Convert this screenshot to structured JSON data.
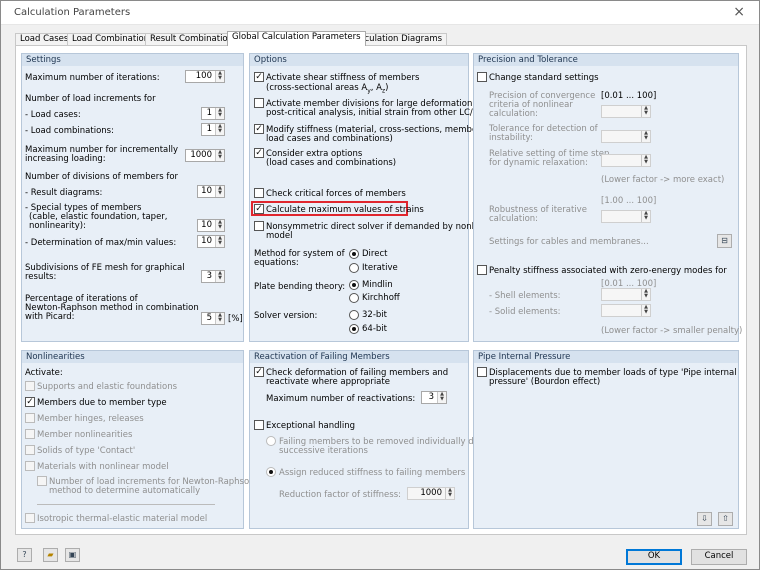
{
  "window": {
    "title": "Calculation Parameters",
    "close": "×"
  },
  "tabs": [
    "Load Cases",
    "Load Combinations",
    "Result Combinations",
    "Global Calculation Parameters",
    "Calculation Diagrams"
  ],
  "settings": {
    "title": "Settings",
    "max_iter_label": "Maximum number of iterations:",
    "max_iter": "100",
    "load_incr_label": "Number of load increments for",
    "load_cases_label": "- Load cases:",
    "load_cases": "1",
    "load_comb_label": "- Load combinations:",
    "load_comb": "1",
    "max_incr_label1": "Maximum number for incrementally",
    "max_incr_label2": "increasing loading:",
    "max_incr": "1000",
    "divisions_label": "Number of divisions of members for",
    "result_diag_label": "- Result diagrams:",
    "result_diag": "10",
    "special_l1": "- Special types of members",
    "special_l2": "(cable, elastic foundation, taper,",
    "special_l3": "nonlinearity):",
    "special": "10",
    "maxmin_label": "- Determination of max/min values:",
    "maxmin": "10",
    "fe_l1": "Subdivisions of FE mesh for graphical",
    "fe_l2": "results:",
    "fe": "3",
    "pct_l1": "Percentage of iterations of",
    "pct_l2": "Newton-Raphson method in combination",
    "pct_l3": "with Picard:",
    "pct": "5",
    "pct_unit": "[%]"
  },
  "options": {
    "title": "Options",
    "o1a": "Activate shear stiffness of members",
    "o1b": "(cross-sectional areas A",
    "o1c": "y",
    "o1d": ", A",
    "o1e": "z",
    "o1f": ")",
    "o2a": "Activate member divisions for large deformation or",
    "o2b": "post-critical analysis, initial strain from other LC/CO",
    "o3a": "Modify stiffness (material, cross-sections, members,",
    "o3b": "load cases and combinations)",
    "o4a": "Consider extra options",
    "o4b": "(load cases and combinations)",
    "o5": "Check critical forces of members",
    "o6": "Calculate maximum values of strains",
    "o7a": "Nonsymmetric direct solver if demanded by nonlinear",
    "o7b": "model",
    "method_l1": "Method for system of",
    "method_l2": "equations:",
    "direct": "Direct",
    "iterative": "Iterative",
    "plate_label": "Plate bending theory:",
    "mindlin": "Mindlin",
    "kirchhoff": "Kirchhoff",
    "solver_label": "Solver version:",
    "bit32": "32-bit",
    "bit64": "64-bit"
  },
  "precision": {
    "title": "Precision and Tolerance",
    "change": "Change standard settings",
    "conv_l1": "Precision of convergence",
    "conv_l2": "criteria of nonlinear",
    "conv_l3": "calculation:",
    "range1": "[0.01 ... 100]",
    "tol_l1": "Tolerance for detection of",
    "tol_l2": "instability:",
    "time_l1": "Relative setting of time step",
    "time_l2": "for dynamic relaxation:",
    "lower_more": "(Lower factor -> more exact)",
    "range2": "[1.00 ... 100]",
    "robust_l1": "Robustness of iterative",
    "robust_l2": "calculation:",
    "cables": "Settings for cables and membranes...",
    "penalty": "Penalty stiffness associated with zero-energy modes for",
    "range3": "[0.01 ... 100]",
    "shell": "- Shell elements:",
    "solid": "- Solid elements:",
    "lower_smaller": "(Lower factor -> smaller penalty)"
  },
  "nonlin": {
    "title": "Nonlinearities",
    "activate": "Activate:",
    "n1": "Supports and elastic foundations",
    "n2": "Members due to member type",
    "n3": "Member hinges, releases",
    "n4": "Member nonlinearities",
    "n5": "Solids of type 'Contact'",
    "n6": "Materials with nonlinear model",
    "n7a": "Number of load increments for Newton-Raphson",
    "n7b": "method to determine automatically",
    "n8": "Isotropic thermal-elastic material model"
  },
  "reactivation": {
    "title": "Reactivation of Failing Members",
    "check_l1": "Check deformation of failing members and",
    "check_l2": "reactivate where appropriate",
    "max_label": "Maximum number of reactivations:",
    "max": "3",
    "exceptional": "Exceptional handling",
    "r1a": "Failing members to be removed individually during",
    "r1b": "successive iterations",
    "r2": "Assign reduced stiffness to failing members",
    "factor_label": "Reduction factor of stiffness:",
    "factor": "1000"
  },
  "pipe": {
    "title": "Pipe Internal Pressure",
    "l1": "Displacements due to member loads of type 'Pipe internal",
    "l2": "pressure' (Bourdon effect)"
  },
  "footer": {
    "ok": "OK",
    "cancel": "Cancel"
  }
}
